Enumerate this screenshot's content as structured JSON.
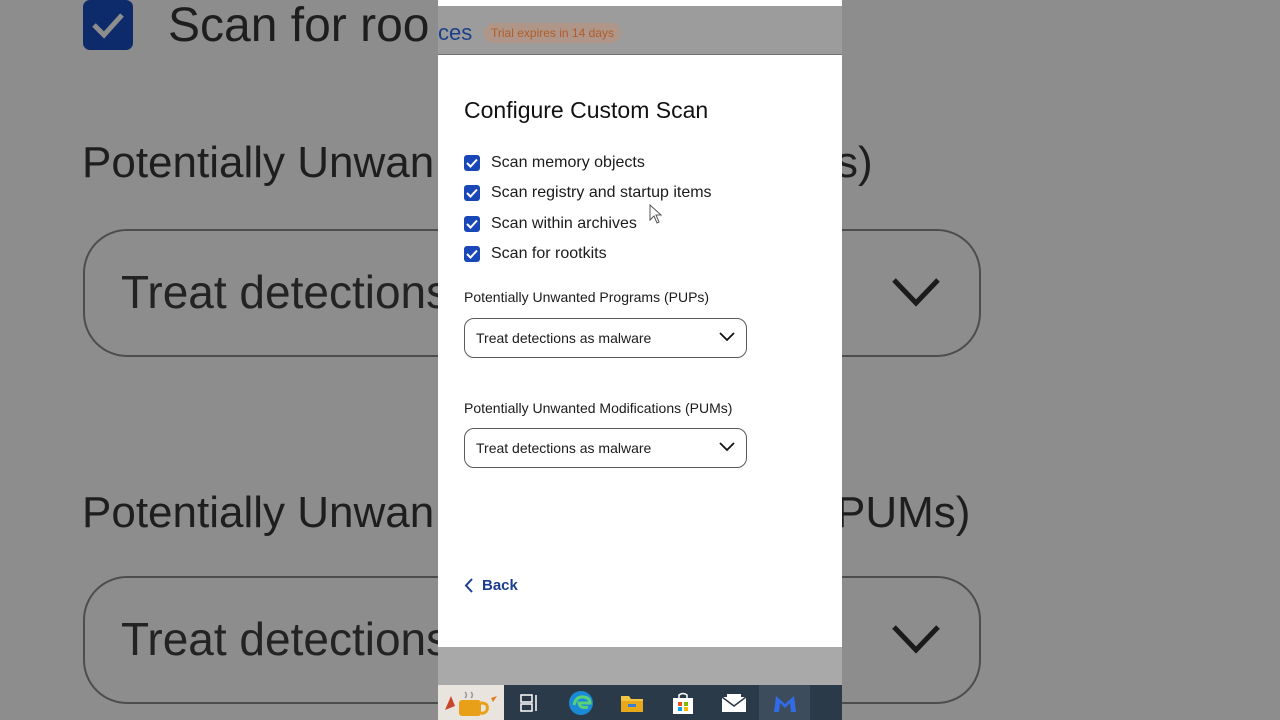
{
  "background": {
    "check_row_text": "Scan for roo",
    "pups_heading_left": "Potentially Unwan",
    "pups_heading_right": "s)",
    "pups_select_text": "Treat detections",
    "pums_heading_left": "Potentially Unwan",
    "pums_heading_right": "PUMs)",
    "pums_select_text": "Treat detections"
  },
  "topbar": {
    "partial_text": "ces",
    "trial_badge": "Trial expires in 14 days"
  },
  "dialog": {
    "title": "Configure Custom Scan",
    "options": [
      {
        "label": "Scan memory objects",
        "checked": true
      },
      {
        "label": "Scan registry and startup items",
        "checked": true
      },
      {
        "label": "Scan within archives",
        "checked": true
      },
      {
        "label": "Scan for rootkits",
        "checked": true
      }
    ],
    "pups": {
      "label": "Potentially Unwanted Programs (PUPs)",
      "value": "Treat detections as malware"
    },
    "pums": {
      "label": "Potentially Unwanted Modifications (PUMs)",
      "value": "Treat detections as malware"
    },
    "back_label": "Back"
  },
  "taskbar": {
    "items": [
      "weather-icon",
      "task-view-icon",
      "edge-icon",
      "file-explorer-icon",
      "store-icon",
      "mail-icon",
      "malwarebytes-icon"
    ]
  },
  "colors": {
    "accent": "#1a47b8",
    "link": "#1a3d8f",
    "taskbar": "#2b3a48"
  }
}
